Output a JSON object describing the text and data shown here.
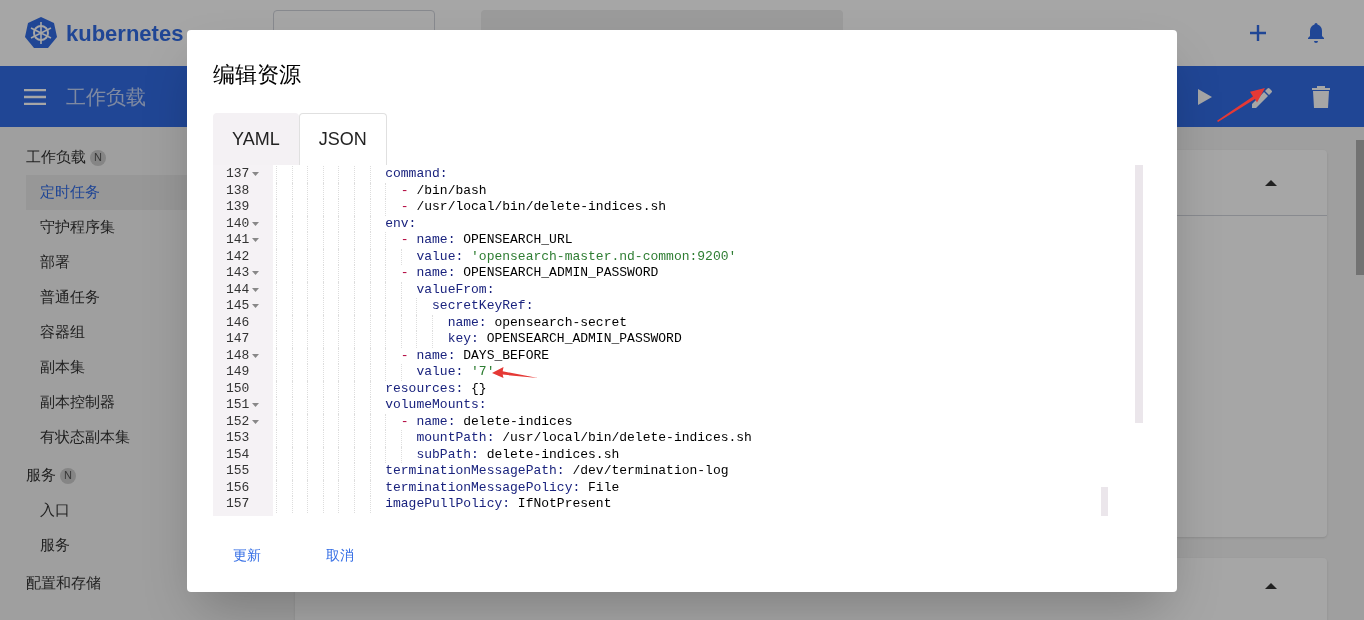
{
  "header": {
    "logo": "kubernetes"
  },
  "breadcrumb": [
    "工作负载"
  ],
  "sidebar": {
    "sections": [
      {
        "label": "工作负载",
        "badge": "N",
        "items": [
          {
            "label": "定时任务",
            "selected": true
          },
          {
            "label": "守护程序集",
            "selected": false
          },
          {
            "label": "部署",
            "selected": false
          },
          {
            "label": "普通任务",
            "selected": false
          },
          {
            "label": "容器组",
            "selected": false
          },
          {
            "label": "副本集",
            "selected": false
          },
          {
            "label": "副本控制器",
            "selected": false
          },
          {
            "label": "有状态副本集",
            "selected": false
          }
        ]
      },
      {
        "label": "服务",
        "badge": "N",
        "items": [
          {
            "label": "入口",
            "selected": false
          },
          {
            "label": "服务",
            "selected": false
          }
        ]
      },
      {
        "label": "配置和存储"
      }
    ]
  },
  "dialog": {
    "title": "编辑资源",
    "tabs": [
      {
        "label": "YAML",
        "selected": false
      },
      {
        "label": "JSON",
        "selected": true
      }
    ],
    "lines": [
      {
        "number": "137",
        "fold": true,
        "tokens": [
          {
            "kind": "key",
            "text": "              command:"
          }
        ]
      },
      {
        "number": "138",
        "fold": false,
        "tokens": [
          {
            "kind": "dash",
            "text": "                -"
          },
          {
            "kind": "plain",
            "text": "/bin/bash"
          }
        ]
      },
      {
        "number": "139",
        "fold": false,
        "tokens": [
          {
            "kind": "dash",
            "text": "                -"
          },
          {
            "kind": "plain",
            "text": "/usr/local/bin/delete-indices.sh"
          }
        ]
      },
      {
        "number": "140",
        "fold": true,
        "tokens": [
          {
            "kind": "key",
            "text": "              env:"
          }
        ]
      },
      {
        "number": "141",
        "fold": true,
        "tokens": [
          {
            "kind": "dash",
            "text": "                -"
          },
          {
            "kind": "key",
            "text": "name:"
          },
          {
            "kind": "plain",
            "text": "OPENSEARCH_URL"
          }
        ]
      },
      {
        "number": "142",
        "fold": false,
        "tokens": [
          {
            "kind": "key",
            "text": "                  value:"
          },
          {
            "kind": "string",
            "text": "'opensearch-master.nd-common:9200'"
          }
        ]
      },
      {
        "number": "143",
        "fold": true,
        "tokens": [
          {
            "kind": "dash",
            "text": "                -"
          },
          {
            "kind": "key",
            "text": "name:"
          },
          {
            "kind": "plain",
            "text": "OPENSEARCH_ADMIN_PASSWORD"
          }
        ]
      },
      {
        "number": "144",
        "fold": true,
        "tokens": [
          {
            "kind": "key",
            "text": "                  valueFrom:"
          }
        ]
      },
      {
        "number": "145",
        "fold": true,
        "tokens": [
          {
            "kind": "key",
            "text": "                    secretKeyRef:"
          }
        ]
      },
      {
        "number": "146",
        "fold": false,
        "tokens": [
          {
            "kind": "key",
            "text": "                      name:"
          },
          {
            "kind": "plain",
            "text": "opensearch-secret"
          }
        ]
      },
      {
        "number": "147",
        "fold": false,
        "tokens": [
          {
            "kind": "key",
            "text": "                      key:"
          },
          {
            "kind": "plain",
            "text": "OPENSEARCH_ADMIN_PASSWORD"
          }
        ]
      },
      {
        "number": "148",
        "fold": true,
        "tokens": [
          {
            "kind": "dash",
            "text": "                -"
          },
          {
            "kind": "key",
            "text": "name:"
          },
          {
            "kind": "plain",
            "text": "DAYS_BEFORE"
          }
        ]
      },
      {
        "number": "149",
        "fold": false,
        "tokens": [
          {
            "kind": "key",
            "text": "                  value:"
          },
          {
            "kind": "string",
            "text": "'7'"
          }
        ],
        "arrow": true
      },
      {
        "number": "150",
        "fold": false,
        "tokens": [
          {
            "kind": "key",
            "text": "              resources:"
          },
          {
            "kind": "plain",
            "text": "{}"
          }
        ]
      },
      {
        "number": "151",
        "fold": true,
        "tokens": [
          {
            "kind": "key",
            "text": "              volumeMounts:"
          }
        ]
      },
      {
        "number": "152",
        "fold": true,
        "tokens": [
          {
            "kind": "dash",
            "text": "                -"
          },
          {
            "kind": "key",
            "text": "name:"
          },
          {
            "kind": "plain",
            "text": "delete-indices"
          }
        ]
      },
      {
        "number": "153",
        "fold": false,
        "tokens": [
          {
            "kind": "key",
            "text": "                  mountPath:"
          },
          {
            "kind": "plain",
            "text": "/usr/local/bin/delete-indices.sh"
          }
        ]
      },
      {
        "number": "154",
        "fold": false,
        "tokens": [
          {
            "kind": "key",
            "text": "                  subPath:"
          },
          {
            "kind": "plain",
            "text": "delete-indices.sh"
          }
        ]
      },
      {
        "number": "155",
        "fold": false,
        "tokens": [
          {
            "kind": "key",
            "text": "              terminationMessagePath:"
          },
          {
            "kind": "plain",
            "text": "/dev/termination-log"
          }
        ]
      },
      {
        "number": "156",
        "fold": false,
        "tokens": [
          {
            "kind": "key",
            "text": "              terminationMessagePolicy:"
          },
          {
            "kind": "plain",
            "text": "File"
          }
        ]
      },
      {
        "number": "157",
        "fold": false,
        "tokens": [
          {
            "kind": "key",
            "text": "              imagePullPolicy:"
          },
          {
            "kind": "plain",
            "text": "IfNotPresent"
          }
        ]
      }
    ],
    "buttons": [
      "更新",
      "取消"
    ]
  }
}
